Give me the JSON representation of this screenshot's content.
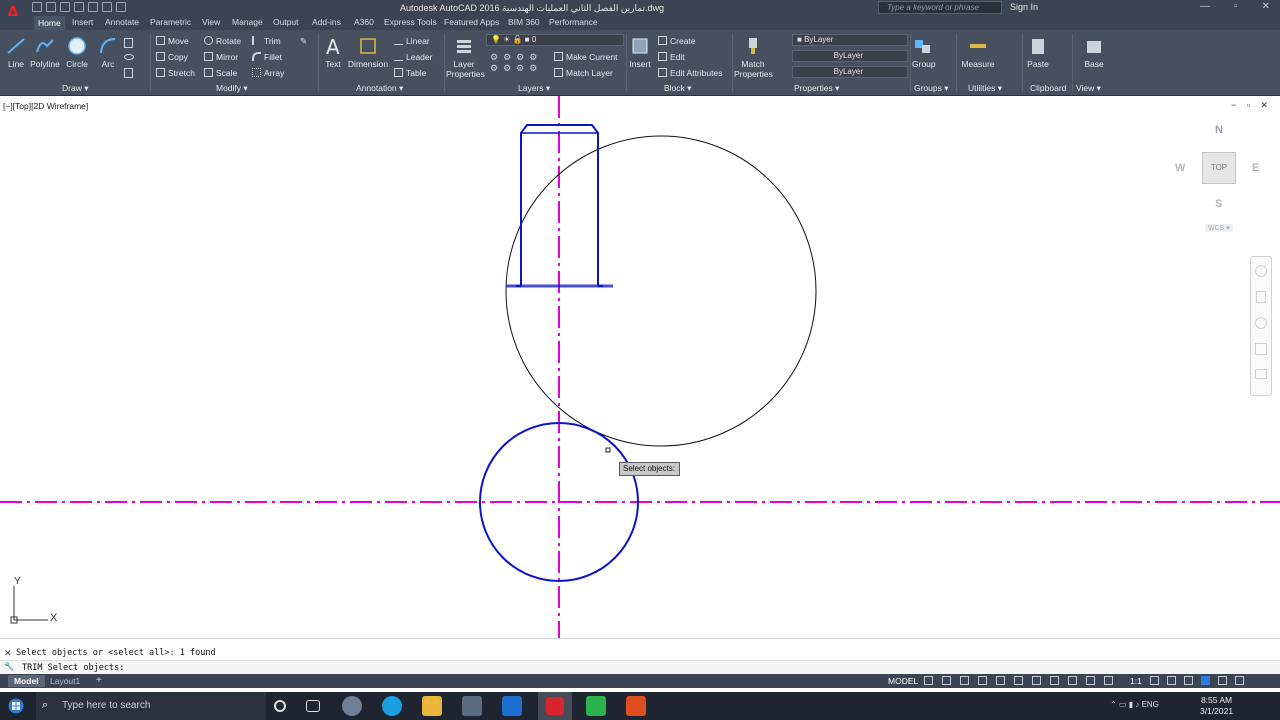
{
  "titlebar": {
    "title": "Autodesk AutoCAD 2016    تمارين الفصل الثاني العمليات الهندسية.dwg",
    "search_placeholder": "Type a keyword or phrase",
    "signin": "Sign In"
  },
  "app": {
    "logo": "A"
  },
  "ribbon_tabs": [
    "Home",
    "Insert",
    "Annotate",
    "Parametric",
    "View",
    "Manage",
    "Output",
    "Add-ins",
    "A360",
    "Express Tools",
    "Featured Apps",
    "BIM 360",
    "Performance"
  ],
  "draw": {
    "line": "Line",
    "polyline": "Polyline",
    "circle": "Circle",
    "arc": "Arc",
    "panel": "Draw ▾"
  },
  "modify": {
    "move": "Move",
    "rotate": "Rotate",
    "trim": "Trim",
    "copy": "Copy",
    "mirror": "Mirror",
    "fillet": "Fillet",
    "stretch": "Stretch",
    "scale": "Scale",
    "array": "Array",
    "panel": "Modify ▾"
  },
  "annotation": {
    "text": "Text",
    "dimension": "Dimension",
    "linear": "Linear",
    "leader": "Leader",
    "table": "Table",
    "panel": "Annotation ▾"
  },
  "layers": {
    "layer_properties": "Layer\nProperties",
    "current_layer": "0",
    "make_current": "Make Current",
    "match_layer": "Match Layer",
    "panel": "Layers ▾"
  },
  "block": {
    "insert": "Insert",
    "create": "Create",
    "edit": "Edit",
    "edit_attributes": "Edit Attributes",
    "panel": "Block ▾"
  },
  "properties": {
    "match": "Match\nProperties",
    "color": "ByLayer",
    "linetype": "ByLayer",
    "lineweight": "ByLayer",
    "panel": "Properties ▾"
  },
  "groups": {
    "group": "Group",
    "panel": "Groups ▾"
  },
  "utilities": {
    "measure": "Measure",
    "panel": "Utilities ▾"
  },
  "clipboard": {
    "paste": "Paste",
    "panel": "Clipboard"
  },
  "view": {
    "base": "Base",
    "panel": "View ▾"
  },
  "viewport": {
    "label": "[−][Top][2D Wireframe]",
    "controls": "− ▫ ✕"
  },
  "viewcube": {
    "north": "N",
    "south": "S",
    "east": "E",
    "west": "W",
    "face": "TOP",
    "wcs": "WCS ▾"
  },
  "ucs": {
    "x": "X",
    "y": "Y"
  },
  "tooltip": "Select objects:",
  "command": {
    "history": "Select objects or <select all>: 1 found",
    "prompt": "TRIM Select objects:"
  },
  "layout": {
    "model": "Model",
    "layout1": "Layout1",
    "add": "+"
  },
  "status": {
    "model": "MODEL",
    "scale": "1:1"
  },
  "taskbar": {
    "search": "Type here to search",
    "lang": "ENG",
    "time": "8:55 AM",
    "date": "3/1/2021"
  },
  "colors": {
    "magenta": "#e000e0",
    "blue": "#0a14c8",
    "ribbon": "#46505f"
  }
}
